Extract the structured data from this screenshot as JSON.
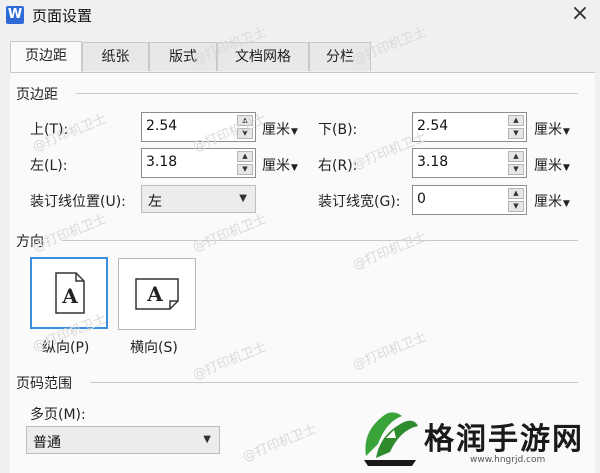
{
  "window": {
    "title": "页面设置",
    "app_icon_letter": "W"
  },
  "tabs": [
    {
      "label": "页边距",
      "active": true
    },
    {
      "label": "纸张",
      "active": false
    },
    {
      "label": "版式",
      "active": false
    },
    {
      "label": "文档网格",
      "active": false
    },
    {
      "label": "分栏",
      "active": false
    }
  ],
  "margins": {
    "section_title": "页边距",
    "top": {
      "label": "上(T):",
      "value": "2.54",
      "unit": "厘米"
    },
    "bottom": {
      "label": "下(B):",
      "value": "2.54",
      "unit": "厘米"
    },
    "left": {
      "label": "左(L):",
      "value": "3.18",
      "unit": "厘米"
    },
    "right": {
      "label": "右(R):",
      "value": "3.18",
      "unit": "厘米"
    },
    "gutter_pos": {
      "label": "装订线位置(U):",
      "value": "左"
    },
    "gutter": {
      "label": "装订线宽(G):",
      "value": "0",
      "unit": "厘米"
    }
  },
  "orientation": {
    "section_title": "方向",
    "portrait": {
      "label": "纵向(P)",
      "glyph": "A",
      "selected": true
    },
    "landscape": {
      "label": "横向(S)",
      "glyph": "A",
      "selected": false
    }
  },
  "pages": {
    "section_title": "页码范围",
    "multi_label": "多页(M):",
    "multi_value": "普通"
  },
  "watermark_text": "@打印机卫士",
  "brand": {
    "text": "格润手游网",
    "url": "www.hngrjd.com",
    "colors": {
      "green": "#3aa33a",
      "dark": "#1a1a1a"
    }
  }
}
